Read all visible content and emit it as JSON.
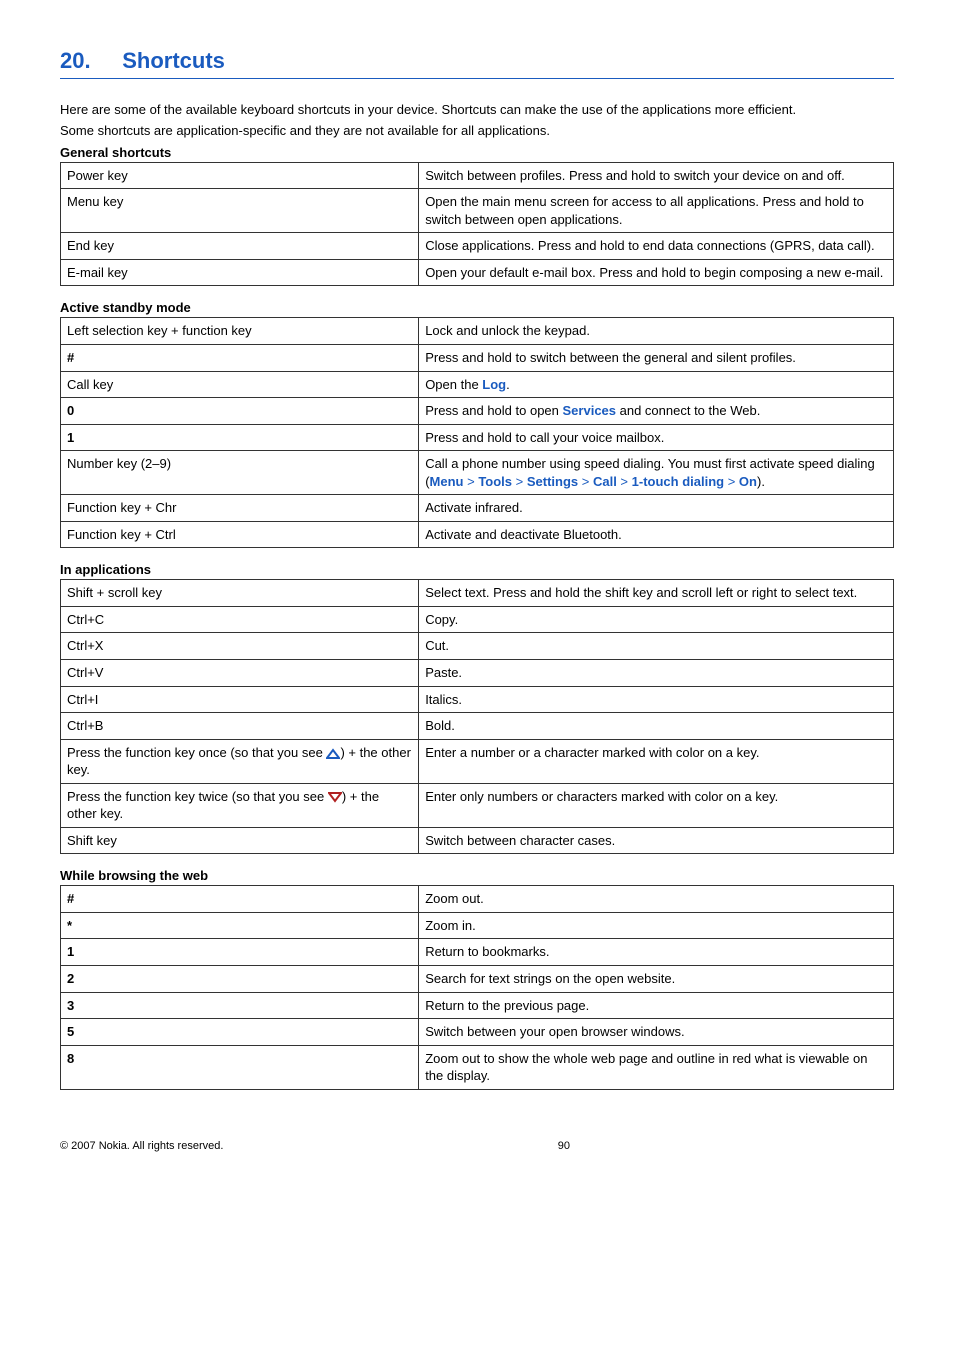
{
  "heading": {
    "number": "20.",
    "title": "Shortcuts"
  },
  "intro": {
    "line1": "Here are some of the available keyboard shortcuts in your device. Shortcuts can make the use of the applications more efficient.",
    "line2": "Some shortcuts are application-specific and they are not available for all applications."
  },
  "general": {
    "heading": "General shortcuts",
    "rows": [
      {
        "k": "Power key",
        "v": "Switch between profiles. Press and hold to switch your device on and off."
      },
      {
        "k": "Menu key",
        "v": "Open the main menu screen for access to all applications. Press and hold to switch between open applications."
      },
      {
        "k": "End key",
        "v": "Close applications. Press and hold to end data connections (GPRS, data call)."
      },
      {
        "k": "E-mail key",
        "v": "Open your default e-mail box. Press and hold to begin composing a new e-mail."
      }
    ]
  },
  "standby": {
    "heading": "Active standby mode",
    "rows": {
      "r0": {
        "k": "Left selection key + function key",
        "v": "Lock and unlock the keypad."
      },
      "r1": {
        "k": "#",
        "v": "Press and hold to switch between the general and silent profiles."
      },
      "r2": {
        "k": "Call key",
        "v_pre": "Open the ",
        "v_link": "Log",
        "v_post": "."
      },
      "r3": {
        "k": "0",
        "v_pre": "Press and hold to open ",
        "v_link": "Services",
        "v_post": " and connect to the Web."
      },
      "r4": {
        "k": "1",
        "v": "Press and hold to call your voice mailbox."
      },
      "r5": {
        "k": "Number key (2–9)",
        "v_pre": "Call a phone number using speed dialing. You must first activate speed dialing (",
        "path": {
          "p0": "Menu",
          "p1": "Tools",
          "p2": "Settings",
          "p3": "Call",
          "p4": "1-touch dialing",
          "p5": "On"
        },
        "v_post": ")."
      },
      "r6": {
        "k": "Function key + Chr",
        "v": "Activate infrared."
      },
      "r7": {
        "k": "Function key + Ctrl",
        "v": "Activate and deactivate Bluetooth."
      }
    }
  },
  "inapp": {
    "heading": "In applications",
    "rows": {
      "r0": {
        "k": "Shift + scroll key",
        "v": "Select text. Press and hold the shift key and scroll left or right to select text."
      },
      "r1": {
        "k": "Ctrl+C",
        "v": "Copy."
      },
      "r2": {
        "k": "Ctrl+X",
        "v": "Cut."
      },
      "r3": {
        "k": "Ctrl+V",
        "v": "Paste."
      },
      "r4": {
        "k": "Ctrl+I",
        "v": "Italics."
      },
      "r5": {
        "k": "Ctrl+B",
        "v": "Bold."
      },
      "r6": {
        "k_pre": "Press the function key once (so that you see ",
        "k_post": ") + the other key.",
        "v": "Enter a number or a character marked with color on a key."
      },
      "r7": {
        "k_pre": "Press the function key twice (so that you see ",
        "k_post": ") + the other key.",
        "v": "Enter only numbers or characters marked with color on a key."
      },
      "r8": {
        "k": "Shift key",
        "v": "Switch between character cases."
      }
    }
  },
  "web": {
    "heading": "While browsing the web",
    "rows": [
      {
        "k": "#",
        "v": "Zoom out."
      },
      {
        "k": "*",
        "v": "Zoom in."
      },
      {
        "k": "1",
        "v": "Return to bookmarks."
      },
      {
        "k": "2",
        "v": "Search for text strings on the open website."
      },
      {
        "k": "3",
        "v": "Return to the previous page."
      },
      {
        "k": "5",
        "v": "Switch between your open browser windows."
      },
      {
        "k": "8",
        "v": "Zoom out to show the whole web page and outline in red what is viewable on the display."
      }
    ]
  },
  "footer": {
    "copyright": "© 2007 Nokia. All rights reserved.",
    "page": "90"
  }
}
